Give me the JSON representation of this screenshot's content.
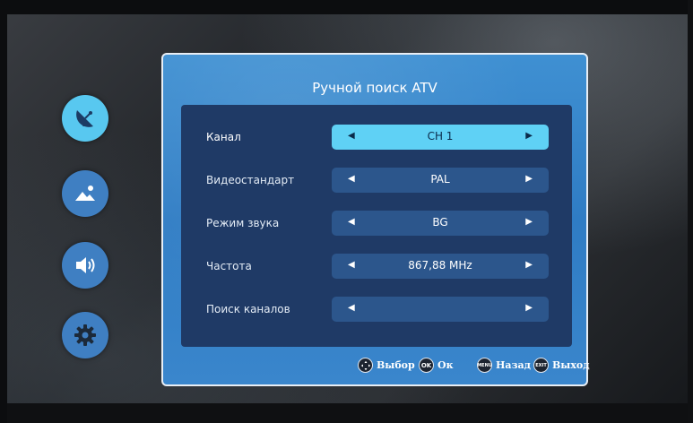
{
  "menu": {
    "sidebar": [
      {
        "name": "channel",
        "icon": "satellite-dish-icon",
        "active": true
      },
      {
        "name": "picture",
        "icon": "picture-icon",
        "active": false
      },
      {
        "name": "sound",
        "icon": "speaker-icon",
        "active": false
      },
      {
        "name": "settings",
        "icon": "gear-icon",
        "active": false
      }
    ],
    "title": "Ручной поиск ATV",
    "rows": [
      {
        "label": "Канал",
        "value": "CH 1",
        "selected": true
      },
      {
        "label": "Видеостандарт",
        "value": "PAL",
        "selected": false
      },
      {
        "label": "Режим звука",
        "value": "BG",
        "selected": false
      },
      {
        "label": "Частота",
        "value": "867,88 MHz",
        "selected": false
      },
      {
        "label": "Поиск каналов",
        "value": "",
        "selected": false
      }
    ],
    "arrows": {
      "left": "◀",
      "right": "▶"
    },
    "footer": {
      "select": {
        "button": "",
        "label": "Выбор"
      },
      "ok": {
        "button": "OK",
        "label": "Ок"
      },
      "back": {
        "button": "MENU",
        "label": "Назад"
      },
      "exit": {
        "button": "EXIT",
        "label": "Выход"
      }
    },
    "colors": {
      "panel": "#3a86cc",
      "inner": "#1f3a66",
      "selected_row": "#5fd1f5",
      "row": "#2c568c",
      "icon_active": "#58c8f0",
      "icon": "#3f7fc2"
    }
  }
}
